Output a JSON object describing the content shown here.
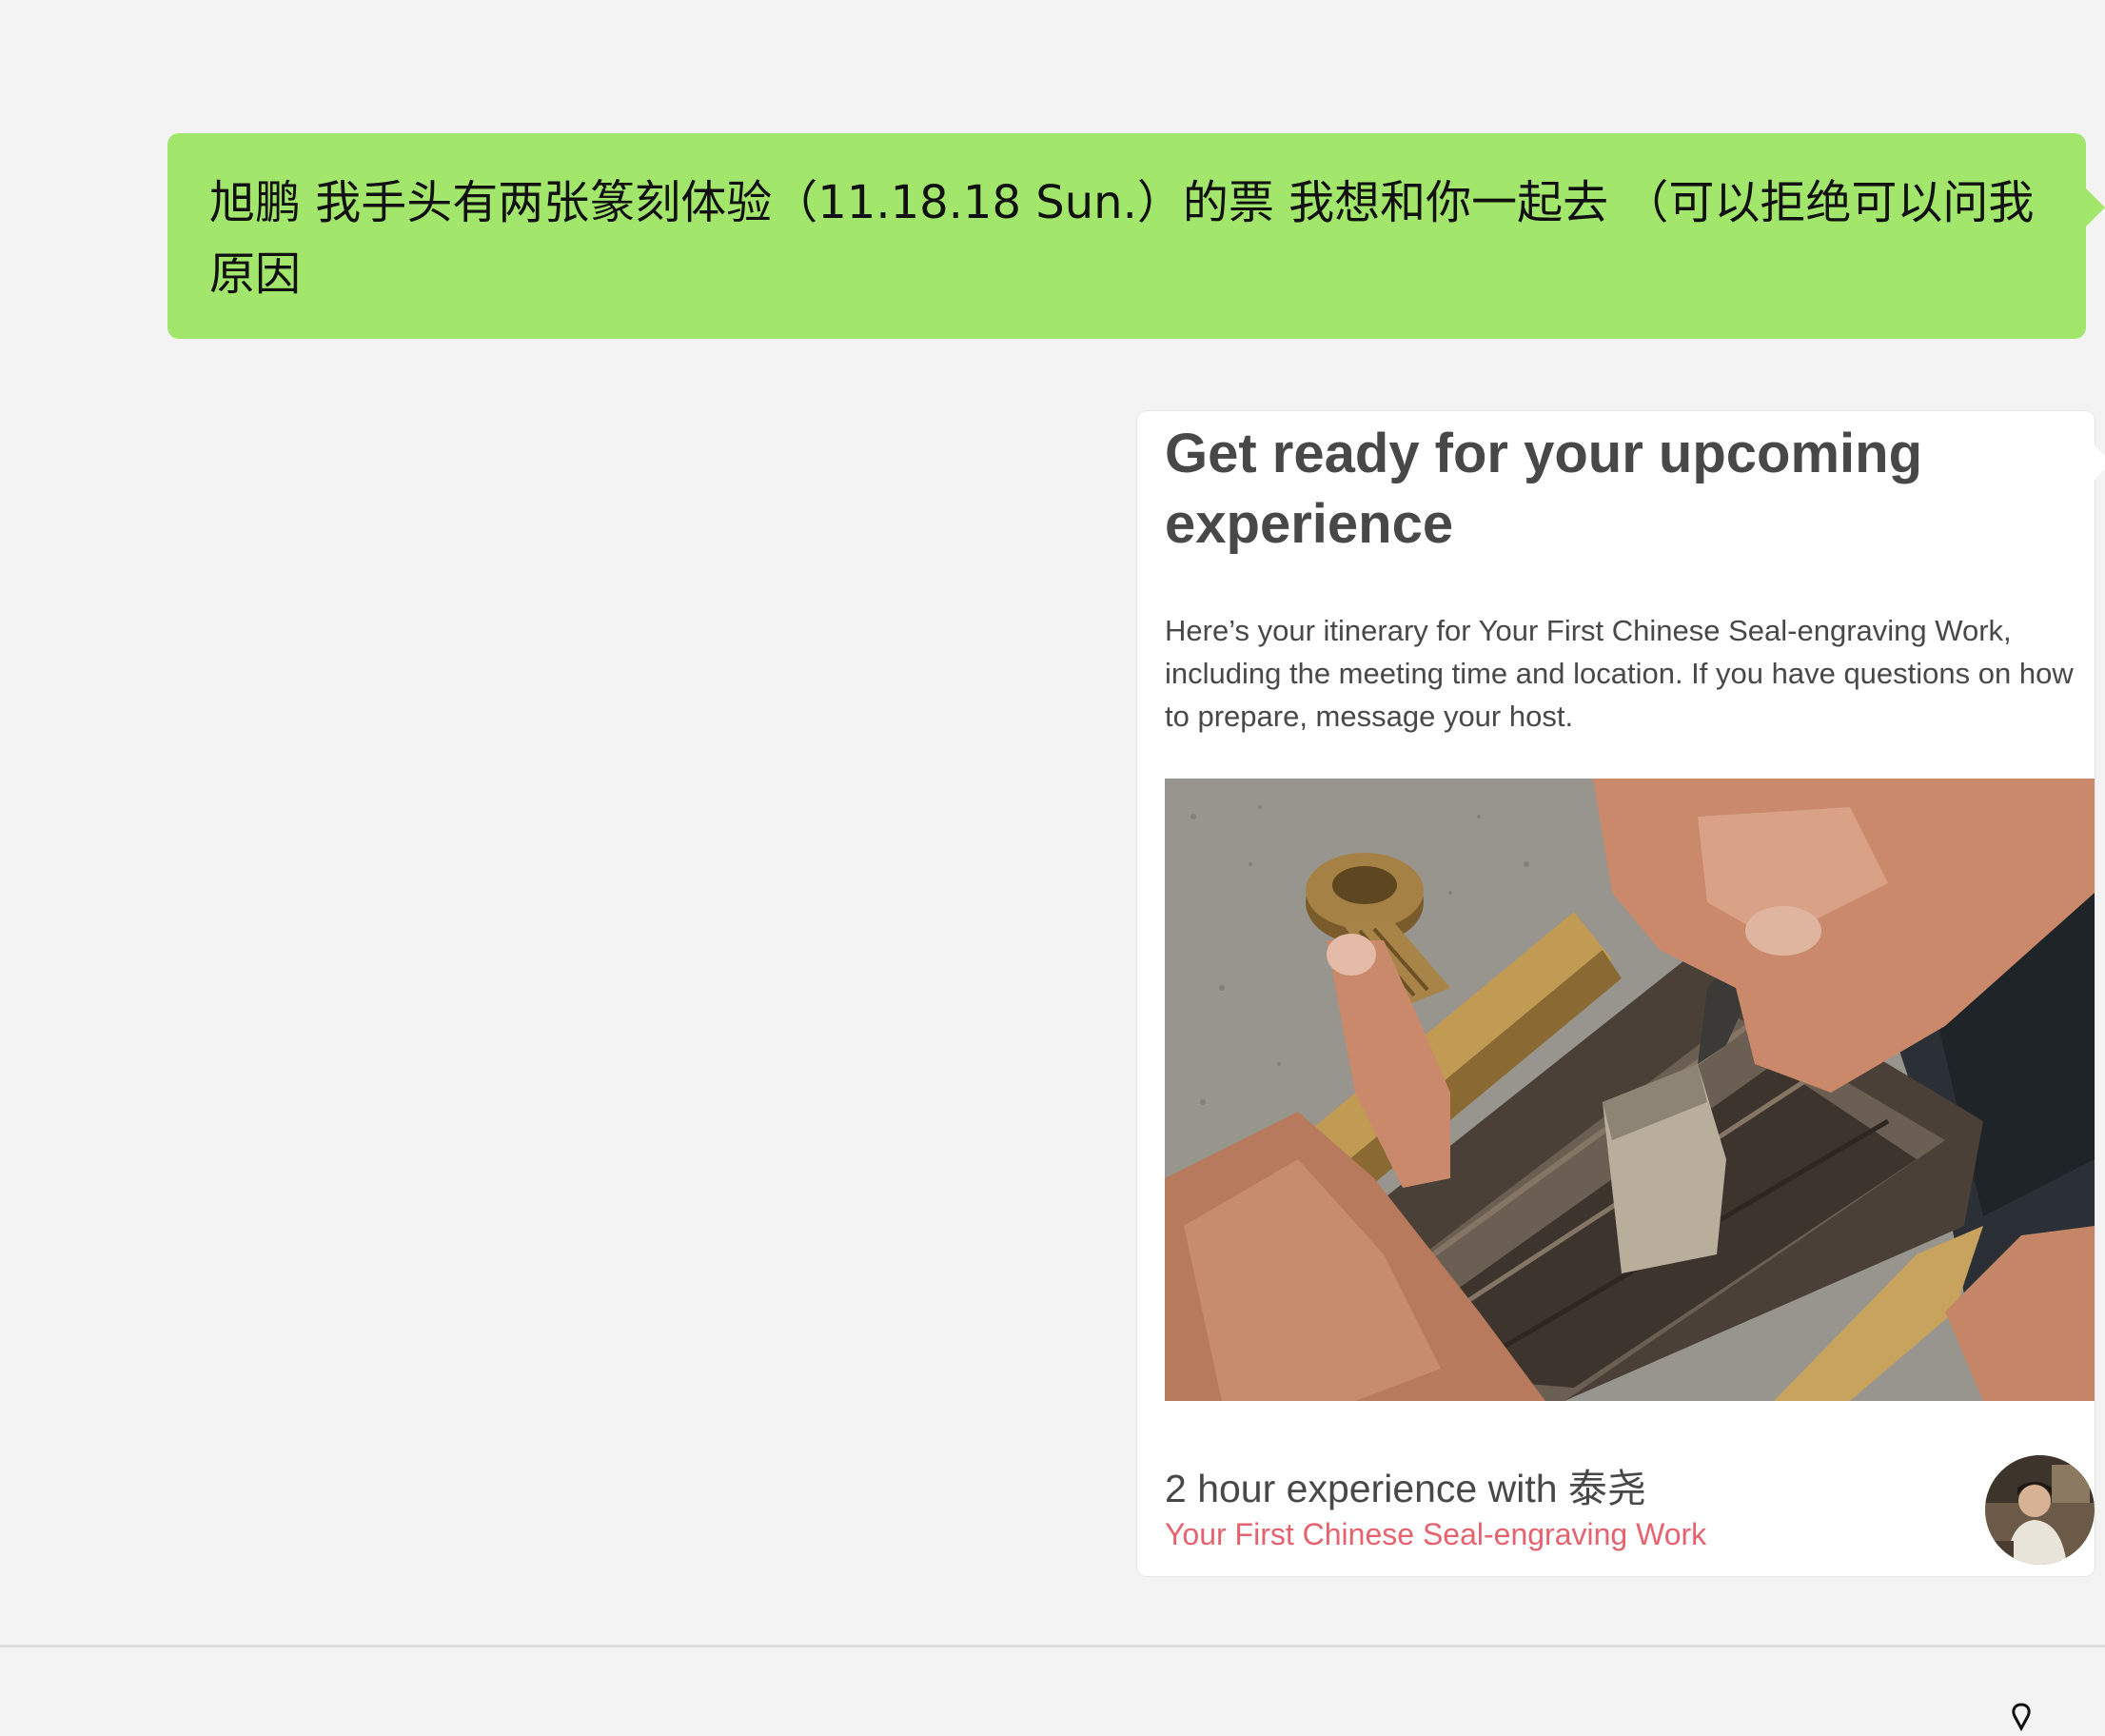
{
  "chat": {
    "message_text": "旭鹏 我手头有两张篆刻体验（11.18.18 Sun.）的票 我想和你一起去 （可以拒绝可以问我原因",
    "bubble_color": "#a2e66b"
  },
  "card": {
    "title": "Get ready for your upcoming experience",
    "description": "Here’s your itinerary for Your First Chinese Seal-engraving Work, including the meeting time and location. If you have questions on how to prepare, message your host.",
    "image_icon": "seal-engraving-photo",
    "footer_title": "2 hour experience with 泰尧",
    "footer_subtitle": "Your First Chinese Seal-engraving Work",
    "footer_subtitle_color": "#e5626f",
    "avatar_icon": "host-avatar"
  },
  "bottom": {
    "icon": "pin-icon"
  }
}
